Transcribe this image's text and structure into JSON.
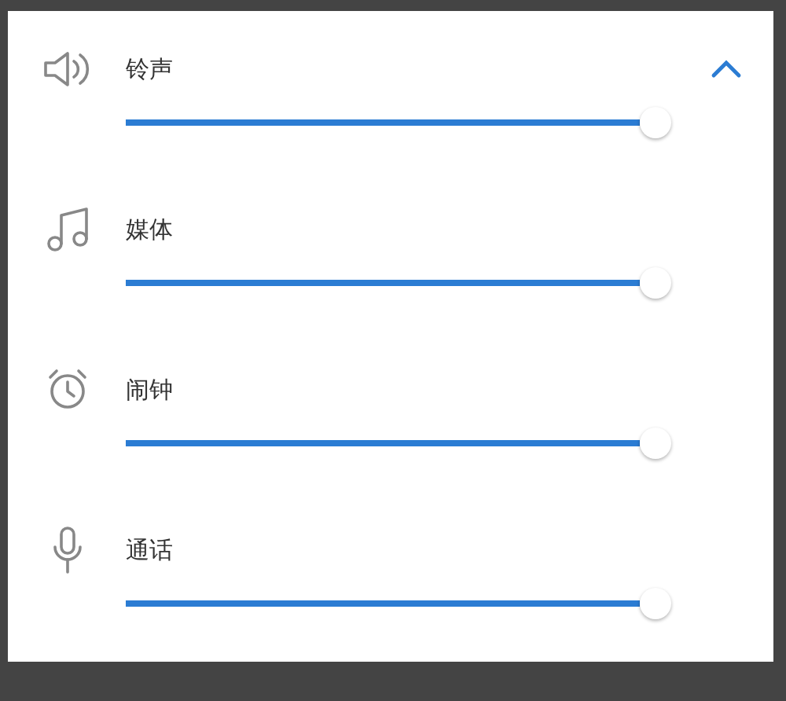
{
  "panel": {
    "expanded": true
  },
  "streams": [
    {
      "kind": "ringtone",
      "label": "铃声",
      "level": 1
    },
    {
      "kind": "media",
      "label": "媒体",
      "level": 1
    },
    {
      "kind": "alarm",
      "label": "闹钟",
      "level": 1
    },
    {
      "kind": "call",
      "label": "通话",
      "level": 1
    }
  ]
}
